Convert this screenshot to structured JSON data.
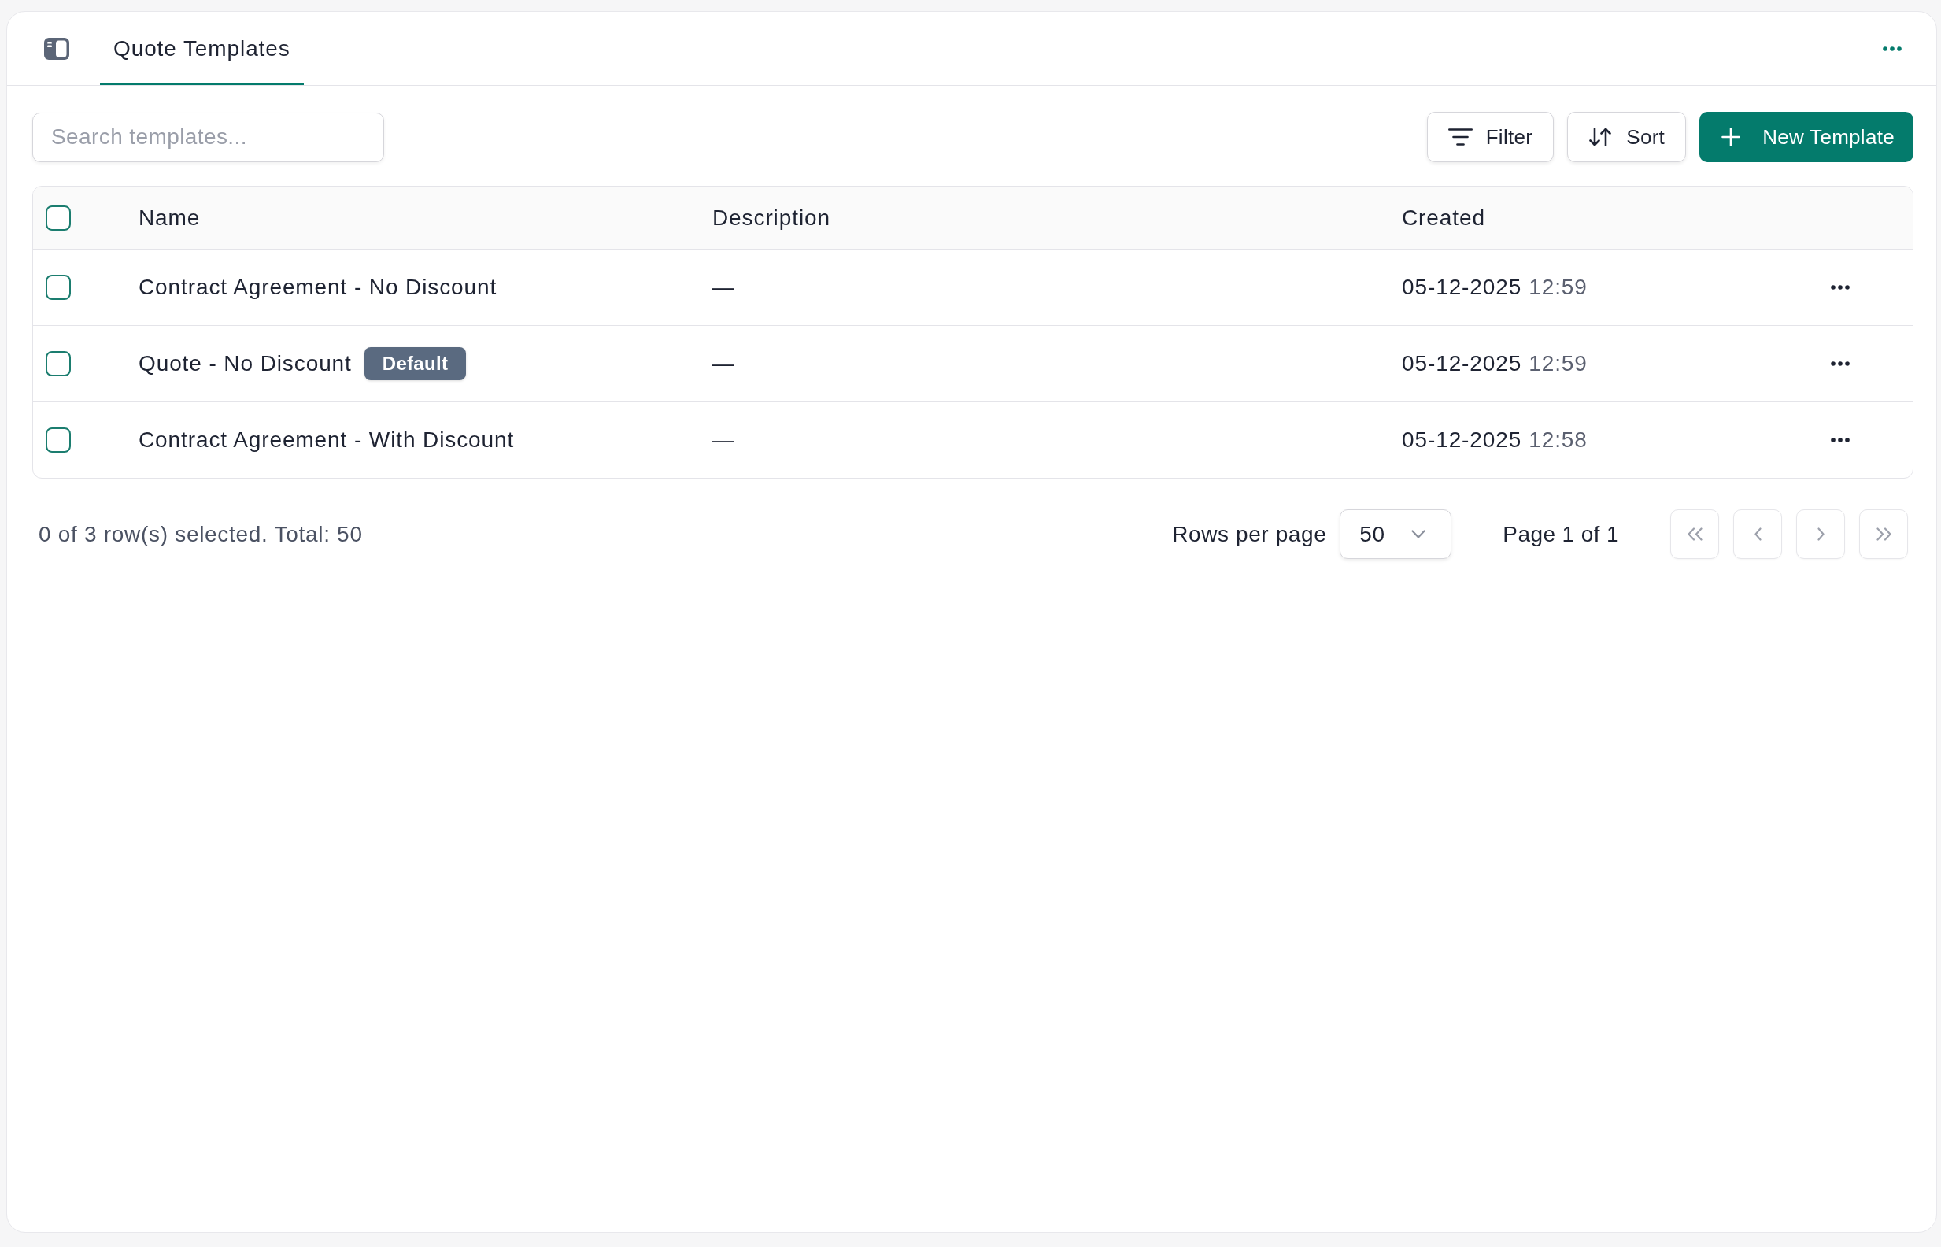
{
  "header": {
    "tabs": [
      {
        "label": "Quote Templates",
        "selected": true
      }
    ]
  },
  "toolbar": {
    "search": {
      "placeholder": "Search templates..."
    },
    "buttons": [
      {
        "kind": "filter",
        "label": "Filter"
      },
      {
        "kind": "sort",
        "label": "Sort"
      },
      {
        "kind": "create",
        "label": "New Template"
      }
    ]
  },
  "table": {
    "select_all": {
      "checked": false
    },
    "columns": [
      "Name",
      "Description",
      "Created"
    ],
    "rows": [
      {
        "checked": false,
        "name": "Contract Agreement - No Discount",
        "description": "—",
        "date": "05-12-2025",
        "time": "12:59"
      },
      {
        "checked": false,
        "name": "Quote - No Discount",
        "badge": "Default",
        "description": "—",
        "date": "05-12-2025",
        "time": "12:59"
      },
      {
        "checked": false,
        "name": "Contract Agreement - With Discount",
        "description": "—",
        "date": "05-12-2025",
        "time": "12:58"
      }
    ]
  },
  "footer": {
    "selection_summary": "0 of 3 row(s) selected. Total: 50",
    "rows_per_page": {
      "label": "Rows per page",
      "value": "50"
    },
    "page_label": "Page 1 of 1",
    "pagination": [
      {
        "kind": "first",
        "disabled": true
      },
      {
        "kind": "previous",
        "disabled": true
      },
      {
        "kind": "next",
        "disabled": true
      },
      {
        "kind": "last",
        "disabled": true
      }
    ]
  }
}
